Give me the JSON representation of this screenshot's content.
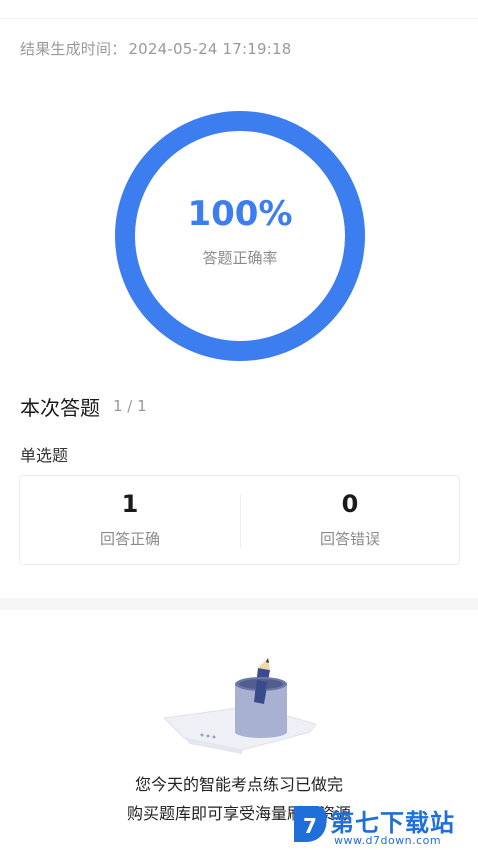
{
  "result": {
    "time_label": "结果生成时间：",
    "time_value": "2024-05-24 17:19:18"
  },
  "accuracy": {
    "percent_text": "100%",
    "progress_fraction": 1.0,
    "label": "答题正确率",
    "ring_color": "#3c7df0"
  },
  "session": {
    "title": "本次答题",
    "count": "1 / 1",
    "question_type": "单选题"
  },
  "stats": {
    "correct_value": "1",
    "correct_label": "回答正确",
    "wrong_value": "0",
    "wrong_label": "回答错误"
  },
  "empty_state": {
    "illustration_icon": "pencil-cup-paper-icon",
    "line1": "您今天的智能考点练习已做完",
    "line2": "购买题库即可享受海量刷题资源"
  },
  "watermark": {
    "title": "第七下载站",
    "url": "www.d7down.com",
    "logo_icon": "d7-logo-icon",
    "color": "#1e6fd9"
  }
}
